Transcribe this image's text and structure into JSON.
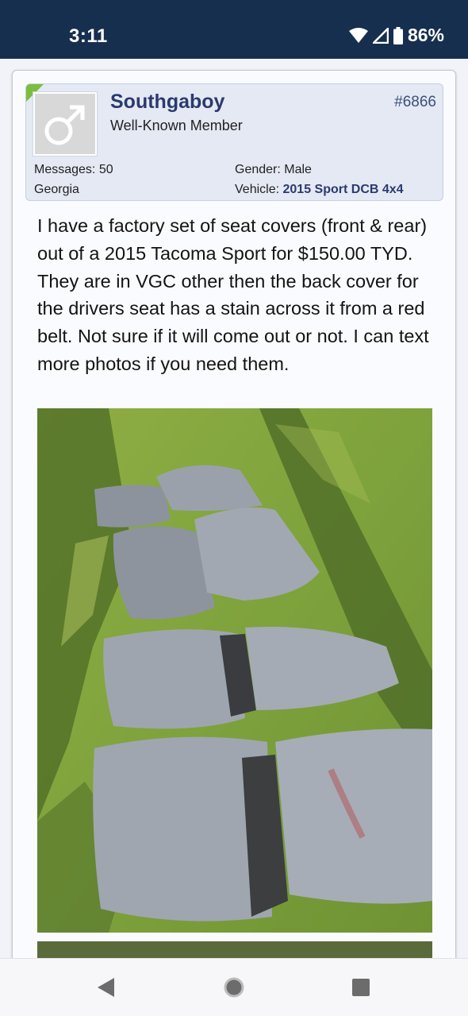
{
  "status_bar": {
    "time": "3:11",
    "battery_percent": "86%",
    "icons": [
      "wifi-icon",
      "signal-icon",
      "battery-icon"
    ]
  },
  "post": {
    "username": "Southgaboy",
    "user_title": "Well-Known Member",
    "post_number": "#6866",
    "messages_label": "Messages:",
    "messages_value": "50",
    "location": "Georgia",
    "gender_label": "Gender:",
    "gender_value": "Male",
    "vehicle_label": "Vehicle:",
    "vehicle_value": "2015 Sport DCB 4x4",
    "avatar_icon": "male-symbol-icon",
    "body": "I have a factory set of seat covers (front & rear) out of a 2015 Tacoma Sport for $150.00 TYD. They are in VGC other then the back cover for the drivers seat has a stain across it from a red belt. Not sure if it will come out or not. I can text more photos if you need them."
  },
  "nav_bar": {
    "icons": [
      "back-icon",
      "home-icon",
      "recents-icon"
    ]
  },
  "colors": {
    "status_bar": "#162f4f",
    "username": "#2b3a6f",
    "header_bg": "#e4e9f4",
    "online_flag": "#7bbd3c"
  }
}
